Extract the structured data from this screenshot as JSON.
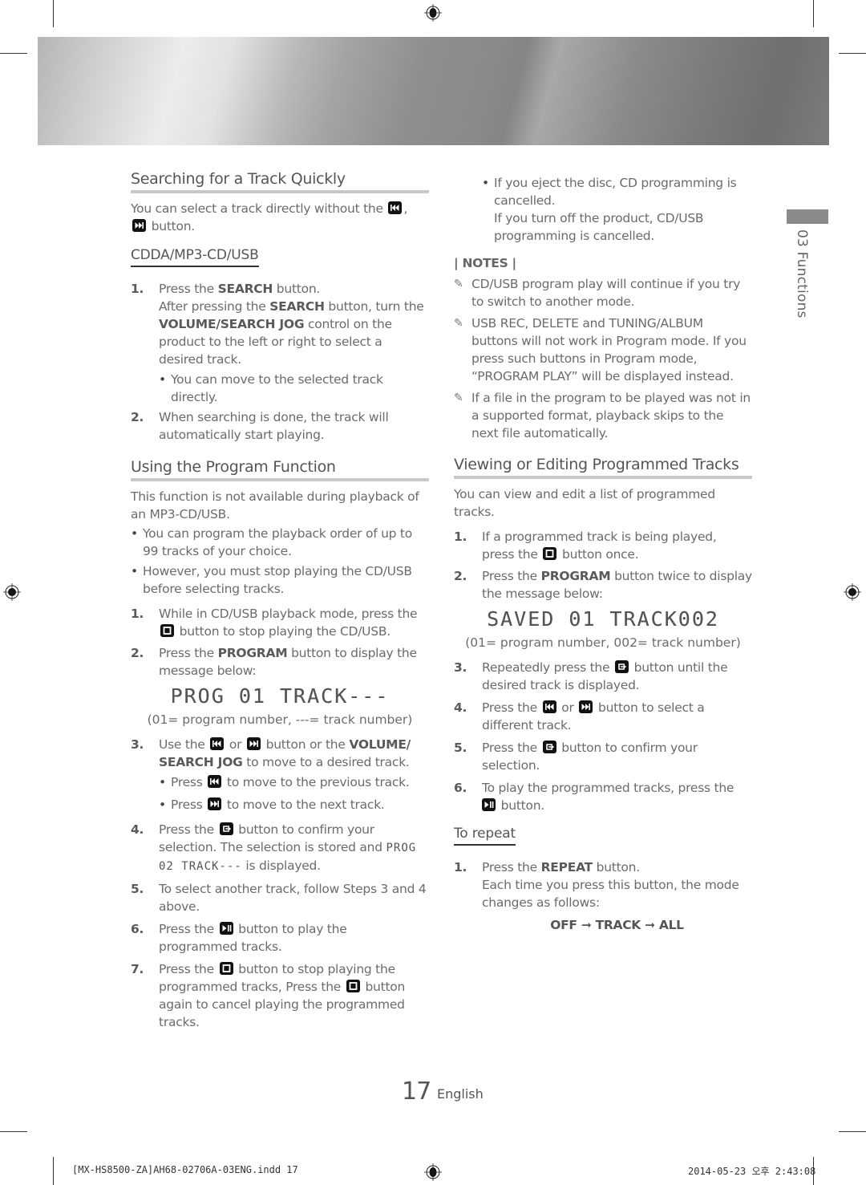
{
  "left": {
    "search_section": {
      "title": "Searching for a Track Quickly",
      "intro_a": "You can select a track directly without the",
      "intro_b": ",",
      "intro_c": "button.",
      "subhead": "CDDA/MP3-CD/USB",
      "steps": [
        {
          "num": "1.",
          "l1_a": "Press the ",
          "l1_b": "SEARCH",
          "l1_c": " button.",
          "l2_a": "After pressing the ",
          "l2_b": "SEARCH",
          "l2_c": " button, turn the ",
          "l2_d": "VOLUME/SEARCH JOG",
          "l2_e": " control on the product to the left or right to select a desired track.",
          "bullet": "You can move to the selected track directly."
        },
        {
          "num": "2.",
          "text": "When searching is done, the track will automatically start playing."
        }
      ]
    },
    "program_section": {
      "title": "Using the Program Function",
      "intro": "This function is not available during playback of an MP3-CD/USB.",
      "bullets": [
        "You can program the playback order of up to 99 tracks of your choice.",
        "However, you must stop playing the CD/USB before selecting tracks."
      ],
      "steps": [
        {
          "num": "1.",
          "a": "While in CD/USB playback mode, press the ",
          "b": " button to stop playing the CD/USB."
        },
        {
          "num": "2.",
          "a": "Press the ",
          "b": "PROGRAM",
          "c": " button to display the message below:"
        },
        {
          "num": "3.",
          "a": "Use the ",
          "b": " or ",
          "c": " button or the ",
          "d": "VOLUME/ SEARCH JOG",
          "e": " to move to a desired track.",
          "bullet1_a": "Press ",
          "bullet1_b": " to move to the previous track.",
          "bullet2_a": "Press ",
          "bullet2_b": " to move to the next track."
        },
        {
          "num": "4.",
          "a": "Press the ",
          "b": " button to confirm your selection. The selection is stored and ",
          "lcd": "PROG 02 TRACK---",
          "c": " is displayed."
        },
        {
          "num": "5.",
          "text": "To select another track, follow Steps 3 and 4 above."
        },
        {
          "num": "6.",
          "a": "Press the ",
          "b": " button to play the programmed tracks."
        },
        {
          "num": "7.",
          "a": "Press the ",
          "b": " button to stop playing the programmed tracks, Press the ",
          "c": " button again to cancel playing the programmed tracks."
        }
      ],
      "display_message": "PROG 01 TRACK---",
      "display_caption": "(01= program number, ---= track number)"
    }
  },
  "right": {
    "top_bullet_l1": "If you eject the disc, CD programming is cancelled.",
    "top_bullet_l2": "If you turn off the product, CD/USB programming is cancelled.",
    "notes_label": "| NOTES |",
    "notes": [
      "CD/USB program play will continue if you try to switch to another mode.",
      "USB REC, DELETE and TUNING/ALBUM buttons will not work in Program mode. If you press such buttons in Program mode, “PROGRAM PLAY” will be displayed instead.",
      "If a file in the program to be played was not in a supported format, playback skips to the next file automatically."
    ],
    "view_section": {
      "title": "Viewing or Editing Programmed Tracks",
      "intro": "You can view and edit a list of programmed tracks.",
      "steps": [
        {
          "num": "1.",
          "a": "If a programmed track is being played, press the ",
          "b": " button once."
        },
        {
          "num": "2.",
          "a": "Press the ",
          "b": "PROGRAM",
          "c": " button twice to display the message below:"
        },
        {
          "num": "3.",
          "a": "Repeatedly press the ",
          "b": " button until the desired track is displayed."
        },
        {
          "num": "4.",
          "a": "Press the ",
          "b": " or ",
          "c": " button to select a different track."
        },
        {
          "num": "5.",
          "a": "Press the ",
          "b": " button to confirm your selection."
        },
        {
          "num": "6.",
          "a": "To play the programmed tracks, press the ",
          "b": " button."
        }
      ],
      "display_message": "SAVED 01 TRACK002",
      "display_caption": "(01= program number, 002= track number)"
    },
    "repeat_section": {
      "subhead": "To repeat",
      "step_num": "1.",
      "l1_a": "Press the ",
      "l1_b": "REPEAT",
      "l1_c": " button.",
      "l2": "Each time you press this button, the mode changes as follows:",
      "sequence": "OFF ➞ TRACK ➞ ALL"
    }
  },
  "side_tab": {
    "label": "03  Functions"
  },
  "footer": {
    "page_number": "17",
    "language": "English",
    "slug_file": "[MX-HS8500-ZA]AH68-02706A-03ENG.indd   17",
    "slug_date": "2014-05-23   오후 2:43:08"
  },
  "icons": {
    "prev": "skip-back-icon",
    "next": "skip-forward-icon",
    "stop": "stop-icon",
    "enter": "enter-icon",
    "play_pause": "play-pause-icon",
    "note": "pencil-note-icon"
  }
}
